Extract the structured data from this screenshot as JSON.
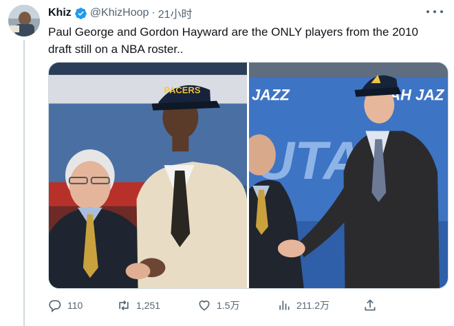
{
  "user": {
    "display_name": "Khiz",
    "handle": "@KhizHoop",
    "separator": "·",
    "time": "21小时",
    "verified": true,
    "verified_color": "#1d9bf0"
  },
  "tweet": {
    "text_line1": "Paul George and Gordon Hayward are the ONLY players from the 2010",
    "text_line2": "draft still on a NBA roster.."
  },
  "media": {
    "left_photo": {
      "alt": "Paul George shaking hands with David Stern at the NBA draft",
      "cap_text": "PACERS"
    },
    "right_photo": {
      "alt": "Gordon Hayward shaking hands with David Stern at the NBA draft",
      "backdrop_text_1": "JAZZ",
      "backdrop_text_2": "AH JAZ",
      "backdrop_text_3": "UTA"
    }
  },
  "actions": {
    "reply": {
      "icon": "reply-icon",
      "count": "110"
    },
    "retweet": {
      "icon": "retweet-icon",
      "count": "1,251"
    },
    "like": {
      "icon": "heart-icon",
      "count": "1.5万"
    },
    "views": {
      "icon": "views-icon",
      "count": "211.2万"
    },
    "share": {
      "icon": "share-icon"
    }
  },
  "colors": {
    "text_primary": "#0f1419",
    "text_secondary": "#536471",
    "accent": "#1d9bf0",
    "border": "#cfd9de"
  }
}
